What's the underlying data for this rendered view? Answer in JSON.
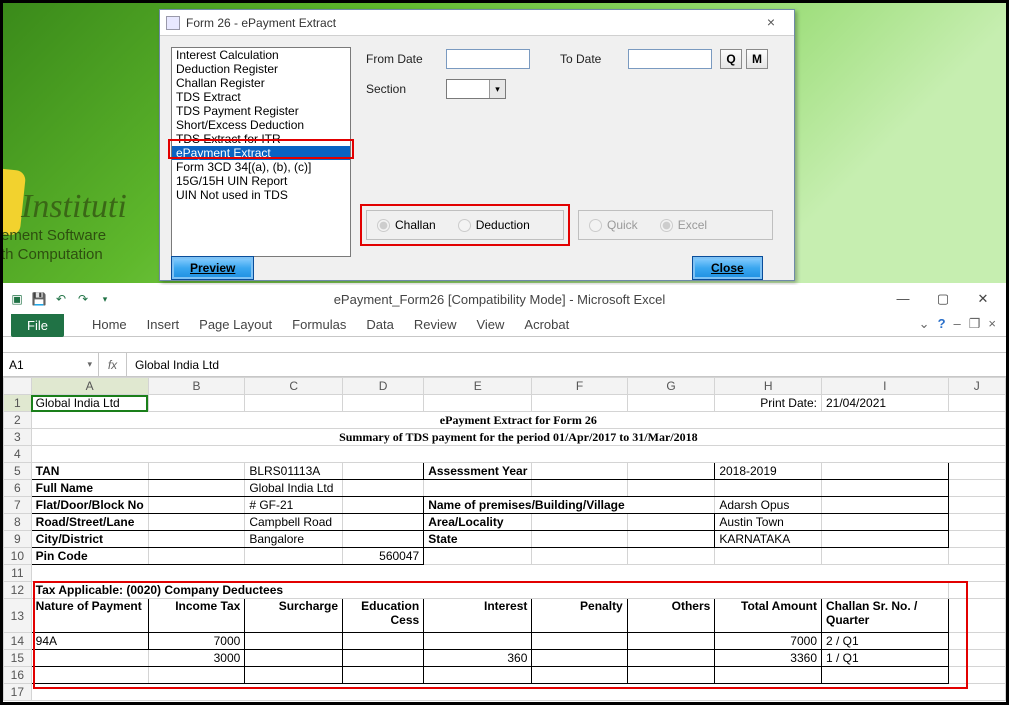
{
  "app_bg": {
    "institute": "Instituti",
    "line_soft": "ement Software",
    "line_comp": "th Computation"
  },
  "dialog": {
    "title": "Form 26 - ePayment Extract",
    "list_items": [
      "Interest Calculation",
      "Deduction Register",
      "Challan Register",
      "TDS Extract",
      "TDS Payment Register",
      "Short/Excess Deduction",
      "TDS Extract for ITR",
      "ePayment Extract",
      "Form 3CD 34[(a), (b), (c)]",
      "15G/15H UIN Report",
      "UIN Not used in TDS"
    ],
    "selected_index": 7,
    "from_label": "From Date",
    "to_label": "To Date",
    "section_label": "Section",
    "q_btn": "Q",
    "m_btn": "M",
    "radio_challan": "Challan",
    "radio_deduction": "Deduction",
    "radio_quick": "Quick",
    "radio_excel": "Excel",
    "preview_btn": "Preview",
    "close_btn": "Close"
  },
  "excel": {
    "title": "ePayment_Form26  [Compatibility Mode]  -  Microsoft Excel",
    "tabs": [
      "File",
      "Home",
      "Insert",
      "Page Layout",
      "Formulas",
      "Data",
      "Review",
      "View",
      "Acrobat"
    ],
    "namebox": "A1",
    "fx_label": "fx",
    "formula_value": "Global India Ltd",
    "col_headers": [
      "A",
      "B",
      "C",
      "D",
      "E",
      "F",
      "G",
      "H",
      "I",
      "J"
    ],
    "print_date_label": "Print Date:",
    "print_date": "21/04/2021",
    "row1_cell": "Global India Ltd",
    "title_line": "ePayment Extract for Form 26",
    "subtitle_line": "Summary of TDS payment for the period 01/Apr/2017 to 31/Mar/2018",
    "info": {
      "tan_l": "TAN",
      "tan_v": "BLRS01113A",
      "ay_l": "Assessment Year",
      "ay_v": "2018-2019",
      "name_l": "Full Name",
      "name_v": "Global India Ltd",
      "flat_l": "Flat/Door/Block No",
      "flat_v": "# GF-21",
      "prem_l": "Name of premises/Building/Village",
      "prem_v": "Adarsh Opus",
      "road_l": "Road/Street/Lane",
      "road_v": "Campbell Road",
      "area_l": "Area/Locality",
      "area_v": "Austin Town",
      "city_l": "City/District",
      "city_v": "Bangalore",
      "state_l": "State",
      "state_v": "KARNATAKA",
      "pin_l": "Pin Code",
      "pin_v": "560047"
    },
    "tax_applicable": "Tax Applicable: (0020) Company Deductees",
    "table_headers": {
      "nature": "Nature of Payment",
      "inc": "Income Tax",
      "sur": "Surcharge",
      "edu_top": "Education",
      "edu_bot": "Cess",
      "int": "Interest",
      "pen": "Penalty",
      "oth": "Others",
      "tot": "Total Amount",
      "chl_top": "Challan Sr. No. /",
      "chl_bot": "Quarter"
    },
    "data_rows": [
      {
        "nature": "94A",
        "inc": "7000",
        "sur": "",
        "edu": "",
        "int": "",
        "pen": "",
        "oth": "",
        "tot": "7000",
        "chl": "2 / Q1"
      },
      {
        "nature": "",
        "inc": "3000",
        "sur": "",
        "edu": "",
        "int": "360",
        "pen": "",
        "oth": "",
        "tot": "3360",
        "chl": "1 / Q1"
      }
    ]
  }
}
